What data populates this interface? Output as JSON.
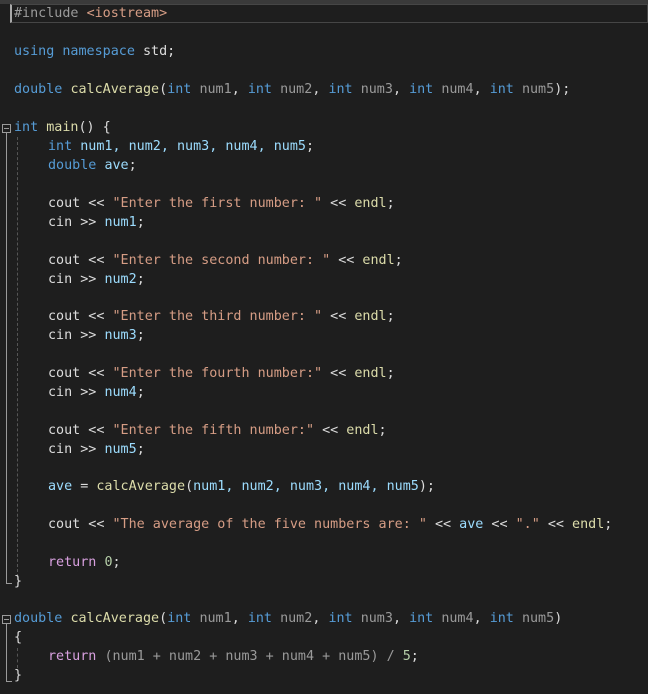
{
  "editor": {
    "lines": {
      "l1": {
        "pre": "#include",
        "inc": "<iostream>"
      },
      "l2": {
        "a": "using",
        "b": "namespace",
        "c": "std;"
      },
      "l3": {
        "type": "double",
        "fn": "calcAverage",
        "p1t": "int",
        "p1": "num1",
        "p2t": "int",
        "p2": "num2",
        "p3t": "int",
        "p3": "num3",
        "p4t": "int",
        "p4": "num4",
        "p5t": "int",
        "p5": "num5",
        "end": ");"
      },
      "l4": {
        "type": "int",
        "fn": "main",
        "rest": "() {"
      },
      "l5": {
        "type": "int",
        "vars": "num1, num2, num3, num4, num5",
        "end": ";"
      },
      "l6": {
        "type": "double",
        "var": "ave",
        "end": ";"
      },
      "c1": {
        "cout": "cout",
        "op": " << ",
        "str": "\"Enter the first number: \"",
        "op2": " << ",
        "endl": "endl",
        "end": ";"
      },
      "n1": {
        "cin": "cin",
        "op": " >> ",
        "var": "num1",
        "end": ";"
      },
      "c2": {
        "cout": "cout",
        "op": " << ",
        "str": "\"Enter the second number: \"",
        "op2": " << ",
        "endl": "endl",
        "end": ";"
      },
      "n2": {
        "cin": "cin",
        "op": " >> ",
        "var": "num2",
        "end": ";"
      },
      "c3": {
        "cout": "cout",
        "op": " << ",
        "str": "\"Enter the third number: \"",
        "op2": " << ",
        "endl": "endl",
        "end": ";"
      },
      "n3": {
        "cin": "cin",
        "op": " >> ",
        "var": "num3",
        "end": ";"
      },
      "c4": {
        "cout": "cout",
        "op": " << ",
        "str": "\"Enter the fourth number:\"",
        "op2": " << ",
        "endl": "endl",
        "end": ";"
      },
      "n4": {
        "cin": "cin",
        "op": " >> ",
        "var": "num4",
        "end": ";"
      },
      "c5": {
        "cout": "cout",
        "op": " << ",
        "str": "\"Enter the fifth number:\"",
        "op2": " << ",
        "endl": "endl",
        "end": ";"
      },
      "n5": {
        "cin": "cin",
        "op": " >> ",
        "var": "num5",
        "end": ";"
      },
      "avecall": {
        "var": "ave",
        "eq": " = ",
        "fn": "calcAverage",
        "open": "(",
        "args": "num1, num2, num3, num4, num5",
        "close": ");"
      },
      "out": {
        "cout": "cout",
        "op": " << ",
        "str": "\"The average of the five numbers are: \"",
        "op2": " << ",
        "var": "ave",
        "op3": " << ",
        "str2": "\".\"",
        "op4": " << ",
        "endl": "endl",
        "end": ";"
      },
      "ret": {
        "kw": "return",
        "num": "0",
        "end": ";"
      },
      "close1": "}",
      "def": {
        "type": "double",
        "fn": "calcAverage",
        "p1t": "int",
        "p1": "num1",
        "p2t": "int",
        "p2": "num2",
        "p3t": "int",
        "p3": "num3",
        "p4t": "int",
        "p4": "num4",
        "p5t": "int",
        "p5": "num5",
        "end": ")"
      },
      "open2": "{",
      "ret2": {
        "kw": "return",
        "expr": "(num1 + num2 + num3 + num4 + num5) / ",
        "num": "5",
        "end": ";"
      },
      "close2": "}"
    }
  }
}
